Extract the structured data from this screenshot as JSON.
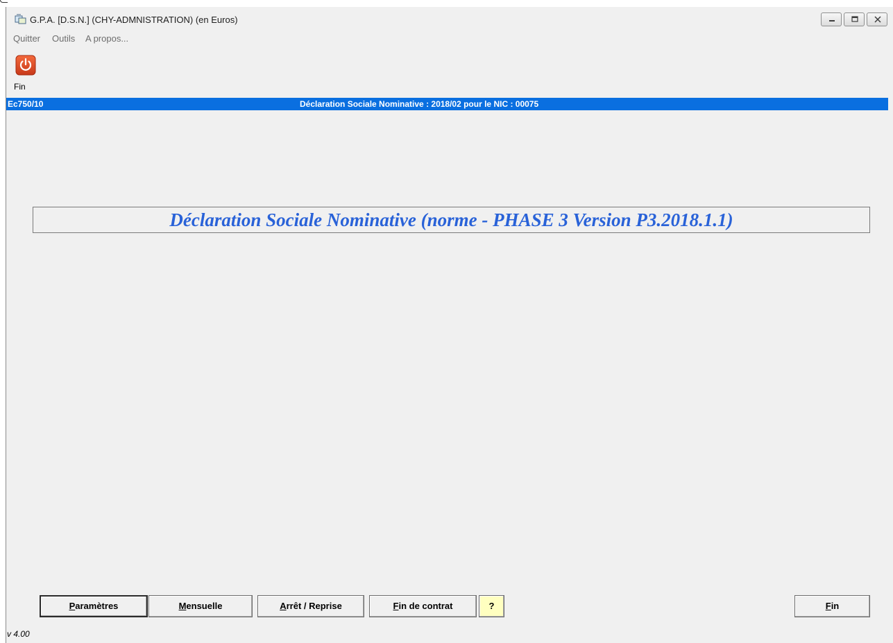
{
  "window": {
    "title": "G.P.A. [D.S.N.] (CHY-ADMNISTRATION) (en Euros)"
  },
  "menu": {
    "items": [
      {
        "label": "Quitter"
      },
      {
        "label": "Outils"
      },
      {
        "label": "A propos..."
      }
    ]
  },
  "toolbar": {
    "fin_label": "Fin",
    "fin_icon": "power-icon",
    "fin_color": "#e04a1e"
  },
  "header": {
    "code": "Ec750/10",
    "title": "Déclaration Sociale Nominative : 2018/02 pour le NIC : 00075",
    "color": "#0a6fe0"
  },
  "banner": {
    "text": "Déclaration Sociale Nominative (norme - PHASE 3 Version P3.2018.1.1)",
    "color": "#2962d8"
  },
  "buttons": {
    "parametres": {
      "accel": "P",
      "rest": "aramètres"
    },
    "mensuelle": {
      "accel": "M",
      "rest": "ensuelle"
    },
    "arret_reprise": {
      "accel": "A",
      "rest": "rrêt / Reprise"
    },
    "fin_contrat": {
      "accel": "F",
      "rest": "in de contrat"
    },
    "help": {
      "label": "?"
    },
    "fin": {
      "accel": "F",
      "rest": "in"
    }
  },
  "status": {
    "version": "v 4.00"
  }
}
